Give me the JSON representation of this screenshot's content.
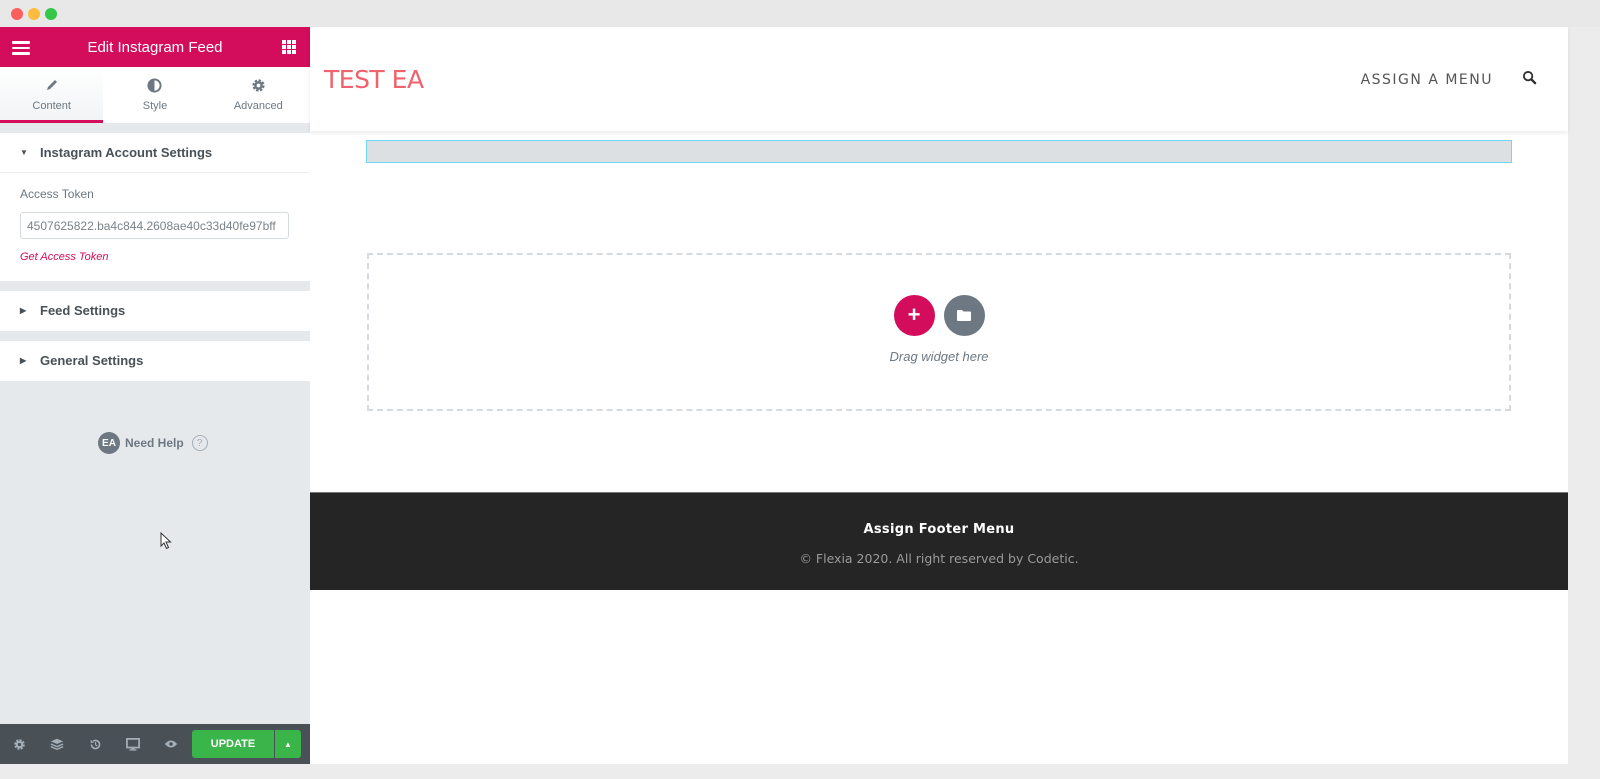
{
  "window": {
    "controls": [
      "close",
      "minimize",
      "maximize"
    ]
  },
  "panel": {
    "title": "Edit Instagram Feed",
    "menu_icon": "hamburger-icon",
    "widgets_icon": "grid-icon",
    "tabs": [
      {
        "label": "Content",
        "icon": "pencil-icon",
        "active": true
      },
      {
        "label": "Style",
        "icon": "contrast-icon",
        "active": false
      },
      {
        "label": "Advanced",
        "icon": "gear-icon",
        "active": false
      }
    ],
    "sections": [
      {
        "label": "Instagram Account Settings",
        "open": true
      },
      {
        "label": "Feed Settings",
        "open": false
      },
      {
        "label": "General Settings",
        "open": false
      }
    ],
    "access_token": {
      "label": "Access Token",
      "value": "4507625822.ba4c844.2608ae40c33d40fe97bff",
      "link": "Get Access Token"
    },
    "need_help": {
      "badge": "EA",
      "label": "Need Help",
      "icon": "?"
    },
    "footer": {
      "icons": [
        "settings-icon",
        "navigator-icon",
        "history-icon",
        "responsive-icon",
        "preview-icon"
      ],
      "update_label": "UPDATE"
    }
  },
  "canvas": {
    "site_title": "TEST EA",
    "menu_link": "ASSIGN A MENU",
    "drop_text": "Drag widget here",
    "add_label": "+",
    "footer_menu": "Assign Footer Menu",
    "copyright": "© Flexia 2020. All right reserved by Codetic."
  },
  "colors": {
    "accent": "#d30c5c",
    "update": "#39b54a",
    "site_title": "#f0626d",
    "footer_bg": "#252525",
    "panel_footer": "#495157"
  }
}
